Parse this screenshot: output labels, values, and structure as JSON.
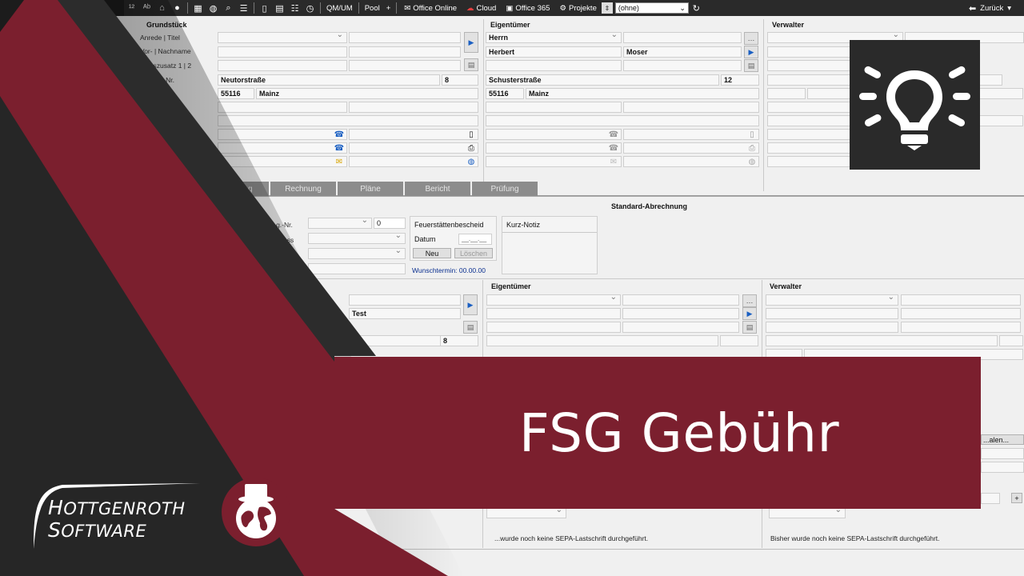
{
  "toolbar": {
    "items": [
      "QM/UM",
      "Pool",
      "+",
      "Office Online",
      "Cloud",
      "Office 365",
      "Projekte"
    ],
    "project_select": "(ohne)",
    "back_label": "Zurück"
  },
  "grundstueck": {
    "title": "Grundstück",
    "labels": [
      "Anrede | Titel",
      "Vor- | Nachname",
      "...enszusatz 1 | 2",
      "... Haus-Nr."
    ],
    "street": "Neutorstraße",
    "house_no": "8",
    "zip": "55116",
    "city": "Mainz"
  },
  "eigentuemer": {
    "title": "Eigentümer",
    "salutation": "Herrn",
    "first_name": "Herbert",
    "last_name": "Moser",
    "street": "Schusterstraße",
    "house_no": "12",
    "zip": "55116",
    "city": "Mainz"
  },
  "verwalter": {
    "title": "Verwalter"
  },
  "tabs": [
    "...ung",
    "Rechnung",
    "Pläne",
    "Bericht",
    "Prüfung"
  ],
  "standard_abrechnung": {
    "title": "Standard-Abrechnung",
    "reg_label": "...g.-Nr.",
    "geschoss_label": "...choss",
    "reg_value": "0",
    "fsb_title": "Feuerstättenbescheid",
    "datum_label": "Datum",
    "datum_value": "__.__.__",
    "neu_label": "Neu",
    "loeschen_label": "Löschen",
    "wunschtermin": "Wunschtermin: 00.00.00",
    "kurz_notiz": "Kurz-Notiz"
  },
  "lower": {
    "eigentuemer_title": "Eigentümer",
    "verwalter_title": "Verwalter",
    "test_value": "Test",
    "house_no": "8",
    "sepa_left": "...wurde noch keine SEPA-Lastschrift durchgeführt.",
    "sepa_right": "Bisher wurde noch keine SEPA-Lastschrift durchgeführt.",
    "partial_label": "...alen...",
    "plus": "+"
  },
  "banner": {
    "title": "FSG Gebühr"
  },
  "brand": {
    "line1": "HOTTGENROTH",
    "line2": "SOFTWARE"
  },
  "colors": {
    "brand_red": "#7b1f2e",
    "dark": "#2a2a2a",
    "toolbar": "#2a2a2a"
  },
  "icons": [
    "lightbulb-icon",
    "top-hat-globe-icon",
    "home-icon",
    "user-icon",
    "search-icon",
    "cloud-icon",
    "clock-icon",
    "back-arrow-icon"
  ]
}
